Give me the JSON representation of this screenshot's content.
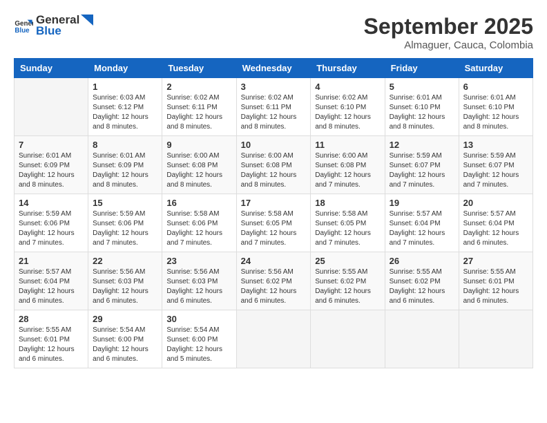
{
  "logo": {
    "general": "General",
    "blue": "Blue"
  },
  "title": {
    "month": "September 2025",
    "location": "Almaguer, Cauca, Colombia"
  },
  "headers": [
    "Sunday",
    "Monday",
    "Tuesday",
    "Wednesday",
    "Thursday",
    "Friday",
    "Saturday"
  ],
  "weeks": [
    [
      {
        "day": "",
        "info": ""
      },
      {
        "day": "1",
        "info": "Sunrise: 6:03 AM\nSunset: 6:12 PM\nDaylight: 12 hours\nand 8 minutes."
      },
      {
        "day": "2",
        "info": "Sunrise: 6:02 AM\nSunset: 6:11 PM\nDaylight: 12 hours\nand 8 minutes."
      },
      {
        "day": "3",
        "info": "Sunrise: 6:02 AM\nSunset: 6:11 PM\nDaylight: 12 hours\nand 8 minutes."
      },
      {
        "day": "4",
        "info": "Sunrise: 6:02 AM\nSunset: 6:10 PM\nDaylight: 12 hours\nand 8 minutes."
      },
      {
        "day": "5",
        "info": "Sunrise: 6:01 AM\nSunset: 6:10 PM\nDaylight: 12 hours\nand 8 minutes."
      },
      {
        "day": "6",
        "info": "Sunrise: 6:01 AM\nSunset: 6:10 PM\nDaylight: 12 hours\nand 8 minutes."
      }
    ],
    [
      {
        "day": "7",
        "info": "Sunrise: 6:01 AM\nSunset: 6:09 PM\nDaylight: 12 hours\nand 8 minutes."
      },
      {
        "day": "8",
        "info": "Sunrise: 6:01 AM\nSunset: 6:09 PM\nDaylight: 12 hours\nand 8 minutes."
      },
      {
        "day": "9",
        "info": "Sunrise: 6:00 AM\nSunset: 6:08 PM\nDaylight: 12 hours\nand 8 minutes."
      },
      {
        "day": "10",
        "info": "Sunrise: 6:00 AM\nSunset: 6:08 PM\nDaylight: 12 hours\nand 8 minutes."
      },
      {
        "day": "11",
        "info": "Sunrise: 6:00 AM\nSunset: 6:08 PM\nDaylight: 12 hours\nand 7 minutes."
      },
      {
        "day": "12",
        "info": "Sunrise: 5:59 AM\nSunset: 6:07 PM\nDaylight: 12 hours\nand 7 minutes."
      },
      {
        "day": "13",
        "info": "Sunrise: 5:59 AM\nSunset: 6:07 PM\nDaylight: 12 hours\nand 7 minutes."
      }
    ],
    [
      {
        "day": "14",
        "info": "Sunrise: 5:59 AM\nSunset: 6:06 PM\nDaylight: 12 hours\nand 7 minutes."
      },
      {
        "day": "15",
        "info": "Sunrise: 5:59 AM\nSunset: 6:06 PM\nDaylight: 12 hours\nand 7 minutes."
      },
      {
        "day": "16",
        "info": "Sunrise: 5:58 AM\nSunset: 6:06 PM\nDaylight: 12 hours\nand 7 minutes."
      },
      {
        "day": "17",
        "info": "Sunrise: 5:58 AM\nSunset: 6:05 PM\nDaylight: 12 hours\nand 7 minutes."
      },
      {
        "day": "18",
        "info": "Sunrise: 5:58 AM\nSunset: 6:05 PM\nDaylight: 12 hours\nand 7 minutes."
      },
      {
        "day": "19",
        "info": "Sunrise: 5:57 AM\nSunset: 6:04 PM\nDaylight: 12 hours\nand 7 minutes."
      },
      {
        "day": "20",
        "info": "Sunrise: 5:57 AM\nSunset: 6:04 PM\nDaylight: 12 hours\nand 6 minutes."
      }
    ],
    [
      {
        "day": "21",
        "info": "Sunrise: 5:57 AM\nSunset: 6:04 PM\nDaylight: 12 hours\nand 6 minutes."
      },
      {
        "day": "22",
        "info": "Sunrise: 5:56 AM\nSunset: 6:03 PM\nDaylight: 12 hours\nand 6 minutes."
      },
      {
        "day": "23",
        "info": "Sunrise: 5:56 AM\nSunset: 6:03 PM\nDaylight: 12 hours\nand 6 minutes."
      },
      {
        "day": "24",
        "info": "Sunrise: 5:56 AM\nSunset: 6:02 PM\nDaylight: 12 hours\nand 6 minutes."
      },
      {
        "day": "25",
        "info": "Sunrise: 5:55 AM\nSunset: 6:02 PM\nDaylight: 12 hours\nand 6 minutes."
      },
      {
        "day": "26",
        "info": "Sunrise: 5:55 AM\nSunset: 6:02 PM\nDaylight: 12 hours\nand 6 minutes."
      },
      {
        "day": "27",
        "info": "Sunrise: 5:55 AM\nSunset: 6:01 PM\nDaylight: 12 hours\nand 6 minutes."
      }
    ],
    [
      {
        "day": "28",
        "info": "Sunrise: 5:55 AM\nSunset: 6:01 PM\nDaylight: 12 hours\nand 6 minutes."
      },
      {
        "day": "29",
        "info": "Sunrise: 5:54 AM\nSunset: 6:00 PM\nDaylight: 12 hours\nand 6 minutes."
      },
      {
        "day": "30",
        "info": "Sunrise: 5:54 AM\nSunset: 6:00 PM\nDaylight: 12 hours\nand 5 minutes."
      },
      {
        "day": "",
        "info": ""
      },
      {
        "day": "",
        "info": ""
      },
      {
        "day": "",
        "info": ""
      },
      {
        "day": "",
        "info": ""
      }
    ]
  ]
}
